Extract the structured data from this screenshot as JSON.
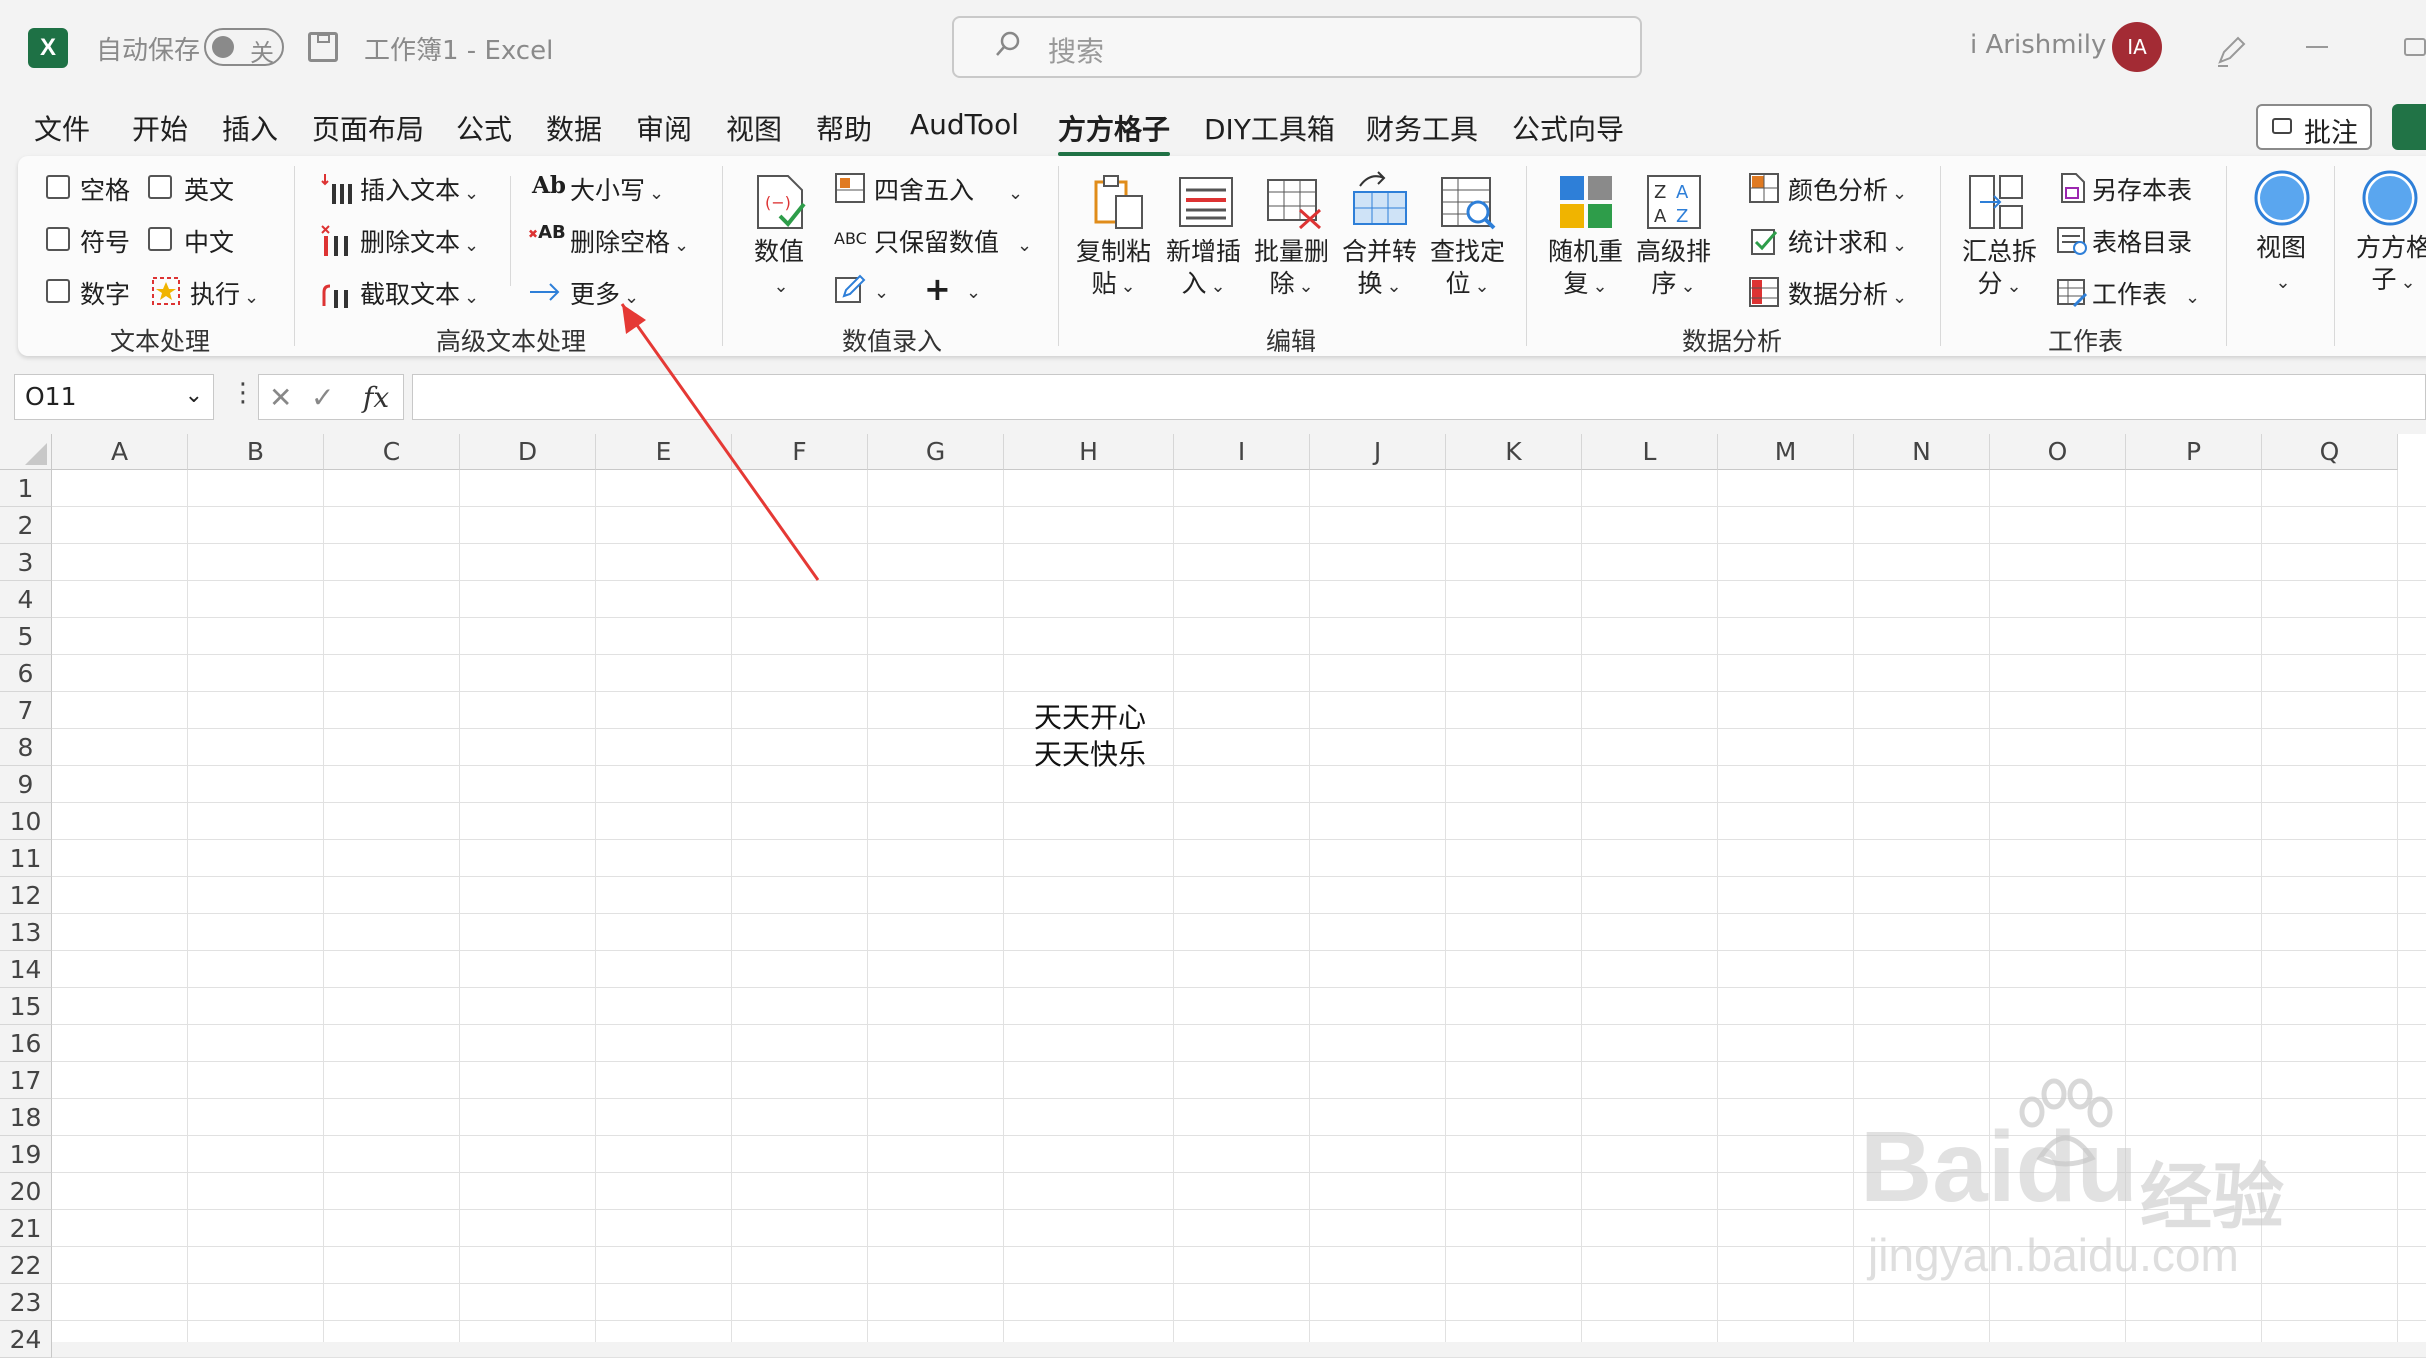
{
  "titlebar": {
    "autosave_label": "自动保存",
    "autosave_state": "关",
    "doc_title": "工作簿1  -  Excel",
    "search_placeholder": "搜索",
    "user_name": "i Arishmily",
    "avatar_initials": "IA",
    "app_logo": "X"
  },
  "menu": {
    "tabs": [
      "文件",
      "开始",
      "插入",
      "页面布局",
      "公式",
      "数据",
      "审阅",
      "视图",
      "帮助",
      "AudTool",
      "方方格子",
      "DIY工具箱",
      "财务工具",
      "公式向导"
    ],
    "active_tab": "方方格子",
    "comment_label": "批注"
  },
  "ribbon": {
    "text_group": {
      "label": "文本处理",
      "space": "空格",
      "english": "英文",
      "symbol": "符号",
      "chinese": "中文",
      "number": "数字",
      "execute": "执行"
    },
    "adv_text_group": {
      "label": "高级文本处理",
      "insert_text": "插入文本",
      "delete_text": "删除文本",
      "extract_text": "截取文本",
      "case": "大小写",
      "delete_space": "删除空格",
      "more": "更多"
    },
    "value_group": {
      "label": "数值录入",
      "value": "数值",
      "round": "四舍五入",
      "keep_value": "只保留数值",
      "abc_icon_text": "ABC",
      "ab_icon_text": "Ab",
      "del_ab_icon_text": "AB",
      "plus": "+"
    },
    "edit_group": {
      "label": "编辑",
      "copy_paste": [
        "复制粘",
        "贴"
      ],
      "new_insert": [
        "新增插",
        "入"
      ],
      "batch_delete": [
        "批量删",
        "除"
      ],
      "merge_convert": [
        "合并转",
        "换"
      ],
      "find_locate": [
        "查找定",
        "位"
      ]
    },
    "analysis_group": {
      "label": "数据分析",
      "random_dup": [
        "随机重",
        "复"
      ],
      "adv_sort": [
        "高级排",
        "序"
      ],
      "color_analysis": "颜色分析",
      "stat_sum": "统计求和",
      "data_analysis": "数据分析"
    },
    "sheet_group": {
      "label": "工作表",
      "summary_split": [
        "汇总拆",
        "分"
      ],
      "save_as_sheet": "另存本表",
      "table_toc": "表格目录",
      "worksheet": "工作表"
    },
    "view_label": "视图",
    "ffgz_label": [
      "方方格",
      "子"
    ]
  },
  "formula_bar": {
    "name_box": "O11",
    "fx": "fx",
    "formula": ""
  },
  "sheet": {
    "columns": [
      "A",
      "B",
      "C",
      "D",
      "E",
      "F",
      "G",
      "H",
      "I",
      "J",
      "K",
      "L",
      "M",
      "N",
      "O",
      "P",
      "Q"
    ],
    "rows": [
      "1",
      "2",
      "3",
      "4",
      "5",
      "6",
      "7",
      "8",
      "9",
      "10",
      "11",
      "12",
      "13",
      "14",
      "15",
      "16",
      "17",
      "18",
      "19",
      "20",
      "21",
      "22",
      "23",
      "24"
    ],
    "cells": {
      "H7": "天天开心",
      "H8": "天天快乐"
    }
  },
  "watermark": {
    "brand": "Baidu",
    "cn": "经验",
    "url": "jingyan.baidu.com"
  },
  "colors": {
    "accent": "#217346",
    "annotation_arrow": "#e53935",
    "avatar": "#a32b34"
  }
}
